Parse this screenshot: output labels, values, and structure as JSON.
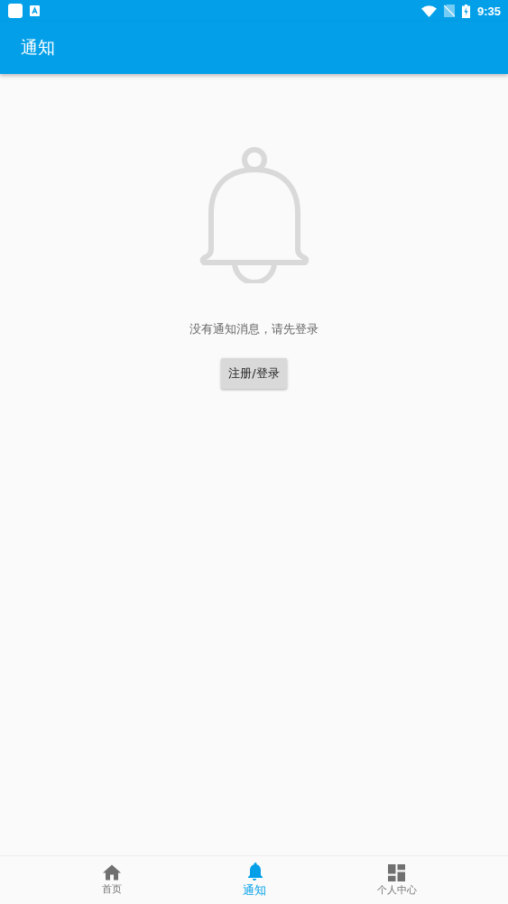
{
  "status_bar": {
    "time": "9:35"
  },
  "app_bar": {
    "title": "通知"
  },
  "empty_state": {
    "message": "没有通知消息，请先登录",
    "button": "注册/登录"
  },
  "bottom_nav": [
    {
      "kind": "home",
      "label": "首页",
      "selected": false
    },
    {
      "kind": "bell",
      "label": "通知",
      "selected": true
    },
    {
      "kind": "dashboard",
      "label": "个人中心",
      "selected": false
    }
  ]
}
